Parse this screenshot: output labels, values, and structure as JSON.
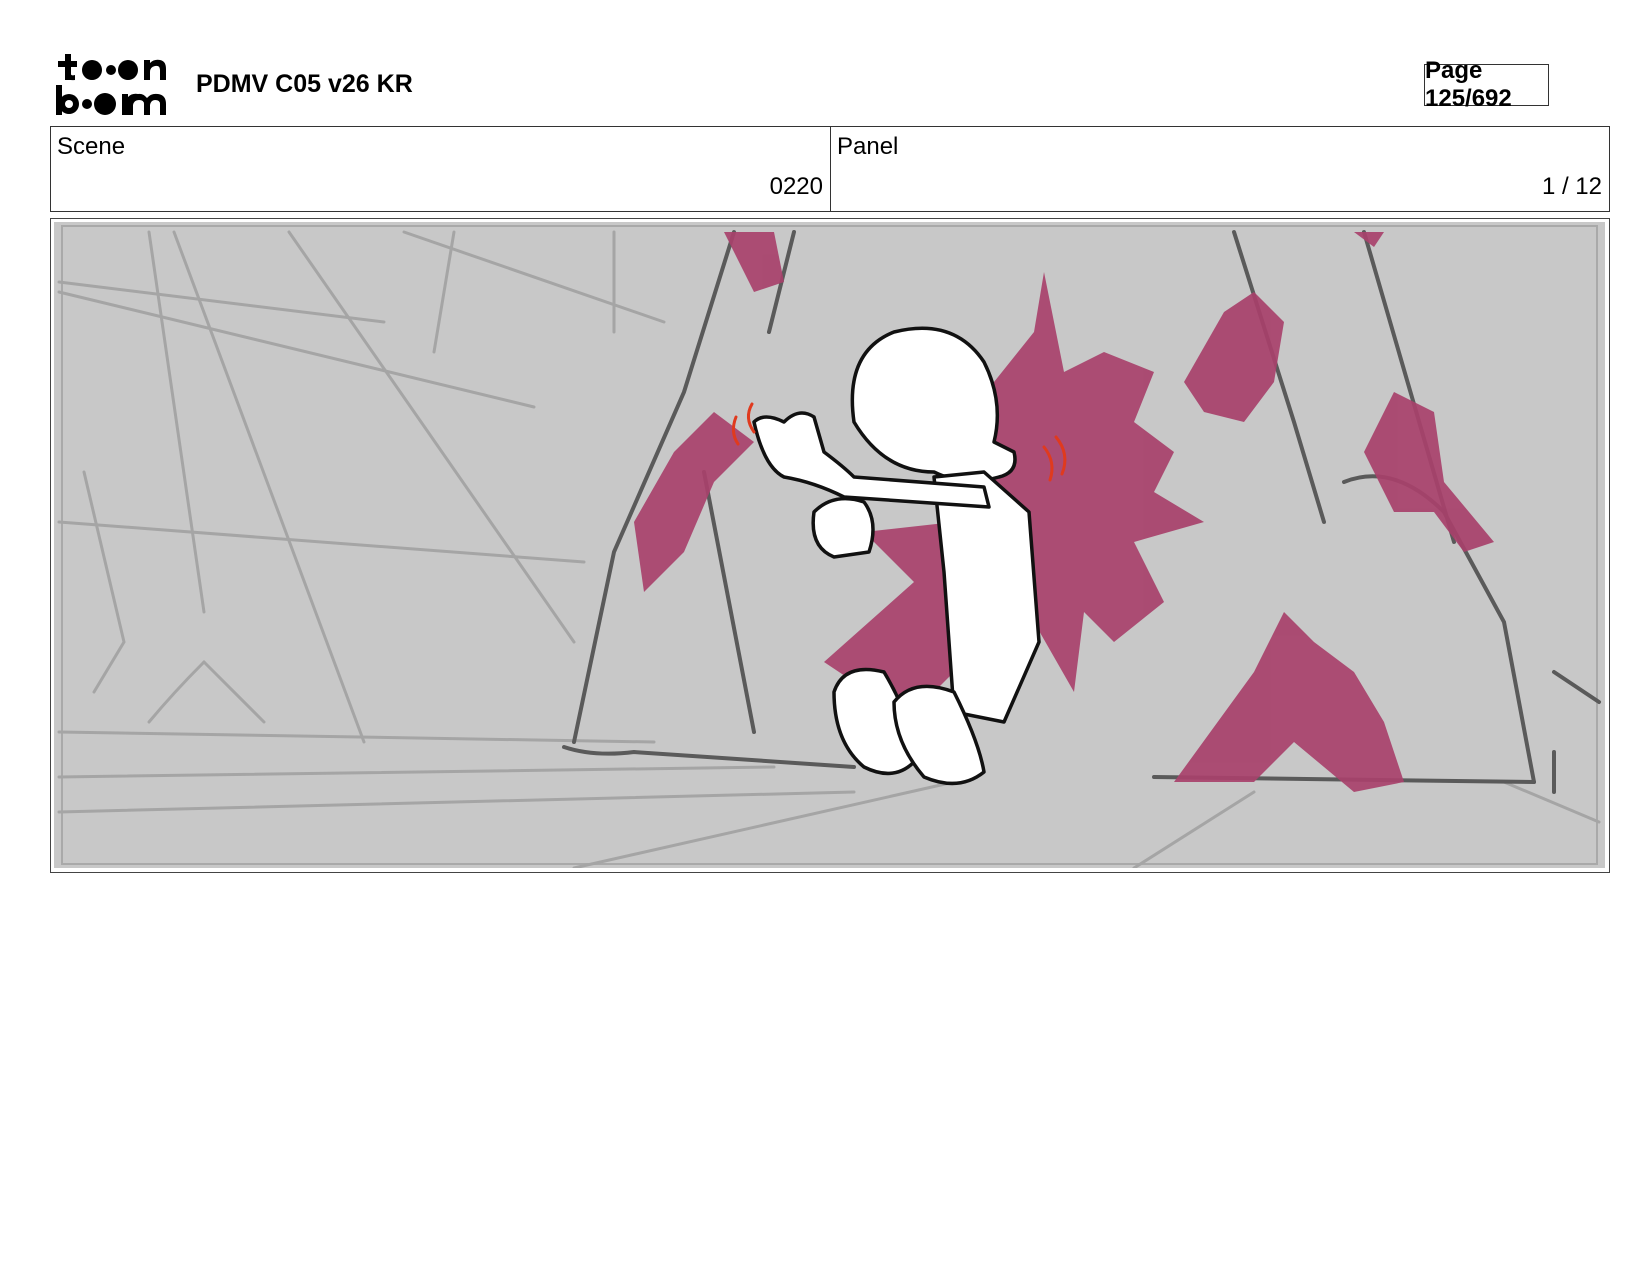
{
  "header": {
    "logo_text": "toon boom",
    "document_title": "PDMV C05 v26 KR",
    "page_indicator": "Page 125/692"
  },
  "scene": {
    "label": "Scene",
    "value": "0220"
  },
  "panel": {
    "label": "Panel",
    "value": "1 / 12"
  },
  "colors": {
    "sketch_background": "#c8c8c8",
    "effect_magenta": "#a8416b",
    "action_red": "#e03a1e",
    "line_dark": "#555555"
  }
}
